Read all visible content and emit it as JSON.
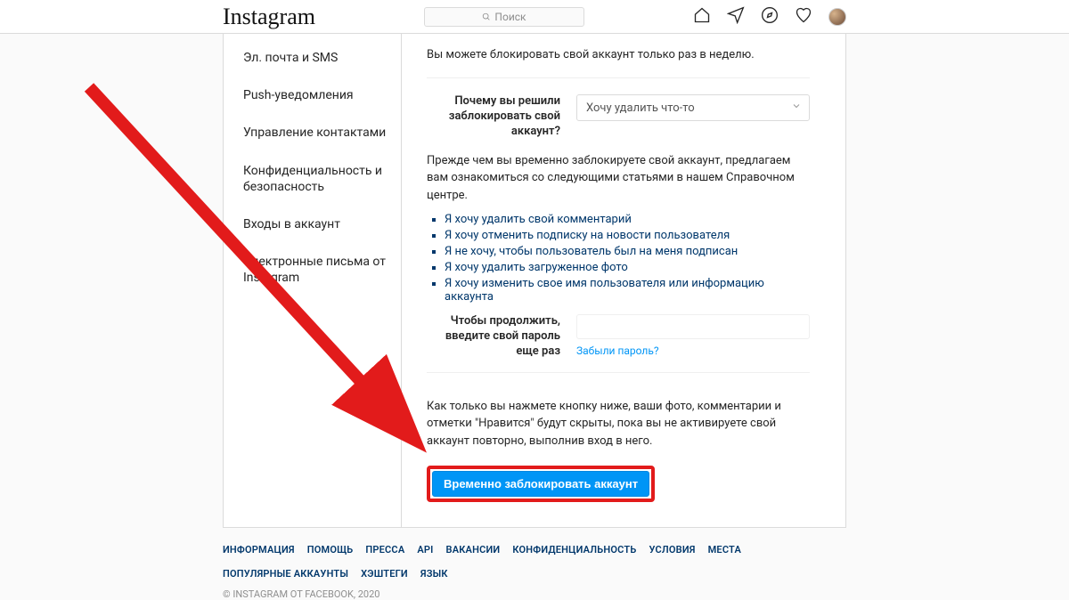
{
  "brand": "Instagram",
  "search": {
    "placeholder": "Поиск"
  },
  "sidebar": {
    "items": [
      {
        "label": "Эл. почта и SMS"
      },
      {
        "label": "Push-уведомления"
      },
      {
        "label": "Управление контактами"
      },
      {
        "label": "Конфиденциальность и безопасность"
      },
      {
        "label": "Входы в аккаунт"
      },
      {
        "label": "Электронные письма от Instagram"
      }
    ]
  },
  "content": {
    "intro": "Вы можете блокировать свой аккаунт только раз в неделю.",
    "reason_label": "Почему вы решили заблокировать свой аккаунт?",
    "reason_selected": "Хочу удалить что-то",
    "help_intro": "Прежде чем вы временно заблокируете свой аккаунт, предлагаем вам ознакомиться со следующими статьями в нашем Справочном центре.",
    "help_links": [
      "Я хочу удалить свой комментарий",
      "Я хочу отменить подписку на новости пользователя",
      "Я не хочу, чтобы пользователь был на меня подписан",
      "Я хочу удалить загруженное фото",
      "Я хочу изменить свое имя пользователя или информацию аккаунта"
    ],
    "password_label": "Чтобы продолжить, введите свой пароль еще раз",
    "forgot": "Забыли пароль?",
    "final": "Как только вы нажмете кнопку ниже, ваши фото, комментарии и отметки \"Нравится\" будут скрыты, пока вы не активируете свой аккаунт повторно, выполнив вход в него.",
    "disable_button": "Временно заблокировать аккаунт"
  },
  "footer": {
    "links": [
      "ИНФОРМАЦИЯ",
      "ПОМОЩЬ",
      "ПРЕССА",
      "API",
      "ВАКАНСИИ",
      "КОНФИДЕНЦИАЛЬНОСТЬ",
      "УСЛОВИЯ",
      "МЕСТА",
      "ПОПУЛЯРНЫЕ АККАУНТЫ",
      "ХЭШТЕГИ",
      "ЯЗЫК"
    ],
    "copyright": "© INSTAGRAM ОТ FACEBOOK, 2020"
  }
}
